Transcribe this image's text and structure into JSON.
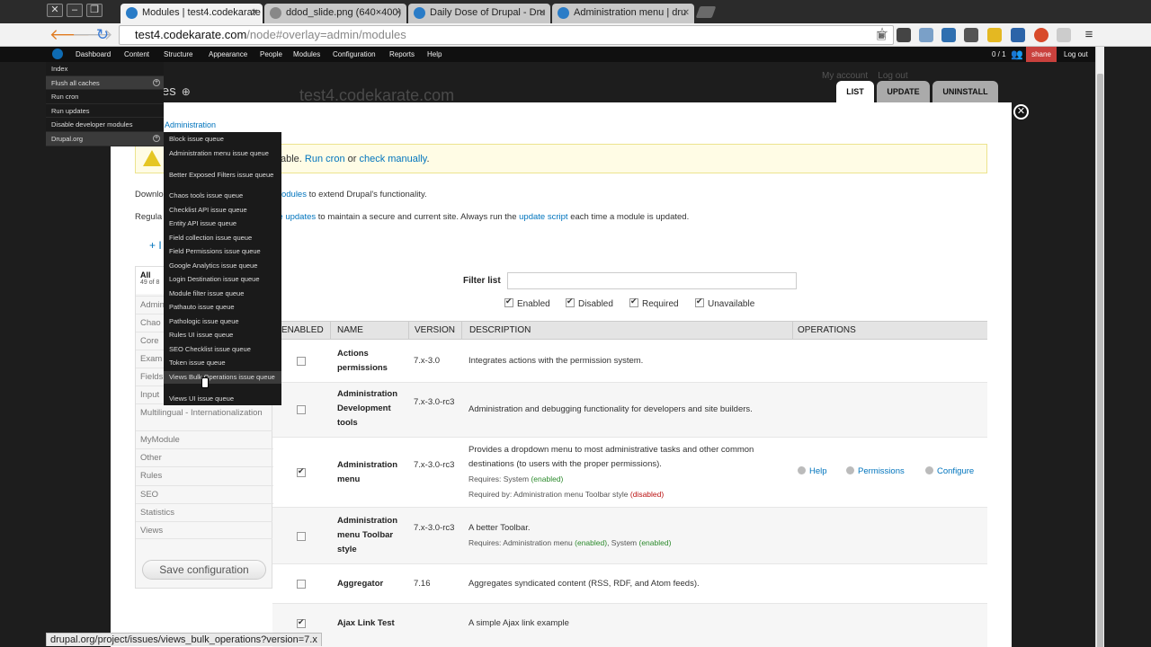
{
  "browser": {
    "tabs": [
      {
        "title": "Modules | test4.codekarate"
      },
      {
        "title": "ddod_slide.png (640×400)"
      },
      {
        "title": "Daily Dose of Drupal - Dru"
      },
      {
        "title": "Administration menu | dru"
      }
    ],
    "url_host": "test4.codekarate.com",
    "url_path": "/node#overlay=admin/modules",
    "status_url": "drupal.org/project/issues/views_bulk_operations?version=7.x"
  },
  "admin_menu": {
    "items": [
      "Dashboard",
      "Content",
      "Structure",
      "Appearance",
      "People",
      "Modules",
      "Configuration",
      "Reports",
      "Help"
    ],
    "counter": "0 / 1",
    "user": "shane",
    "logout": "Log out",
    "dropdown": [
      "Index",
      "Flush all caches",
      "Run cron",
      "Run updates",
      "Disable developer modules",
      "Drupal.org"
    ],
    "sub_dropdown": [
      "Block issue queue",
      "Administration menu issue queue",
      "Better Exposed Filters issue queue",
      "Chaos tools issue queue",
      "Checklist API issue queue",
      "Entity API issue queue",
      "Field collection issue queue",
      "Field Permissions issue queue",
      "Google Analytics issue queue",
      "Login Destination issue queue",
      "Module filter issue queue",
      "Pathauto issue queue",
      "Pathologic issue queue",
      "Rules UI issue queue",
      "SEO Checklist issue queue",
      "Token issue queue",
      "Views Bulk Operations issue queue",
      "Views UI issue queue"
    ]
  },
  "site": {
    "name": "test4.codekarate.com",
    "my_account": "My account",
    "log_out": "Log out"
  },
  "overlay": {
    "title": "Modules",
    "tabs": [
      "LIST",
      "UPDATE",
      "UNINSTALL"
    ],
    "breadcrumb": "Administration",
    "warning_suffix": "ailable.",
    "warning_run_cron": "Run cron",
    "warning_or": "or",
    "warning_check": "check manually",
    "warning_end": ".",
    "intro1_start": "Downlo",
    "intro1_link": "odules",
    "intro1_end": "to extend Drupal's functionality.",
    "intro2_start": "Regula",
    "intro2_link": "e updates",
    "intro2_mid": "to maintain a secure and current site. Always run the",
    "intro2_link2": "update script",
    "intro2_end": "each time a module is updated.",
    "install_link": "+ I"
  },
  "packages": {
    "all_label": "All",
    "all_count": "49 of 8",
    "items": [
      "Admin",
      "Chao",
      "Core",
      "Exam",
      "Fields",
      "Input",
      "Multilingual - Internationalization",
      "MyModule",
      "Other",
      "Rules",
      "SEO",
      "Statistics",
      "Views"
    ],
    "save_button": "Save configuration"
  },
  "filter": {
    "label": "Filter list",
    "value": "",
    "checks": [
      {
        "label": "Enabled",
        "checked": true
      },
      {
        "label": "Disabled",
        "checked": true
      },
      {
        "label": "Required",
        "checked": true
      },
      {
        "label": "Unavailable",
        "checked": true
      }
    ]
  },
  "table": {
    "headers": [
      "ENABLED",
      "NAME",
      "VERSION",
      "DESCRIPTION",
      "OPERATIONS"
    ],
    "rows": [
      {
        "name": "Actions permissions",
        "version": "7.x-3.0",
        "description": "Integrates actions with the permission system.",
        "enabled": false
      },
      {
        "name": "Administration Development tools",
        "version": "7.x-3.0-rc3",
        "description": "Administration and debugging functionality for developers and site builders.",
        "enabled": false
      },
      {
        "name": "Administration menu",
        "version": "7.x-3.0-rc3",
        "description": "Provides a dropdown menu to most administrative tasks and other common destinations (to users with the proper permissions).",
        "requires_label": "Requires: System",
        "requires_state": "(enabled)",
        "required_by_label": "Required by: Administration menu Toolbar style",
        "required_by_state": "(disabled)",
        "enabled": true,
        "ops": [
          "Help",
          "Permissions",
          "Configure"
        ]
      },
      {
        "name": "Administration menu Toolbar style",
        "version": "7.x-3.0-rc3",
        "description": "A better Toolbar.",
        "requires_label": "Requires: Administration menu",
        "requires_state": "(enabled)",
        "requires_label2": ", System",
        "requires_state2": "(enabled)",
        "enabled": false
      },
      {
        "name": "Aggregator",
        "version": "7.16",
        "description": "Aggregates syndicated content (RSS, RDF, and Atom feeds).",
        "enabled": false
      },
      {
        "name": "Ajax Link Test",
        "version": "",
        "description": "A simple Ajax link example",
        "enabled": true
      }
    ]
  }
}
